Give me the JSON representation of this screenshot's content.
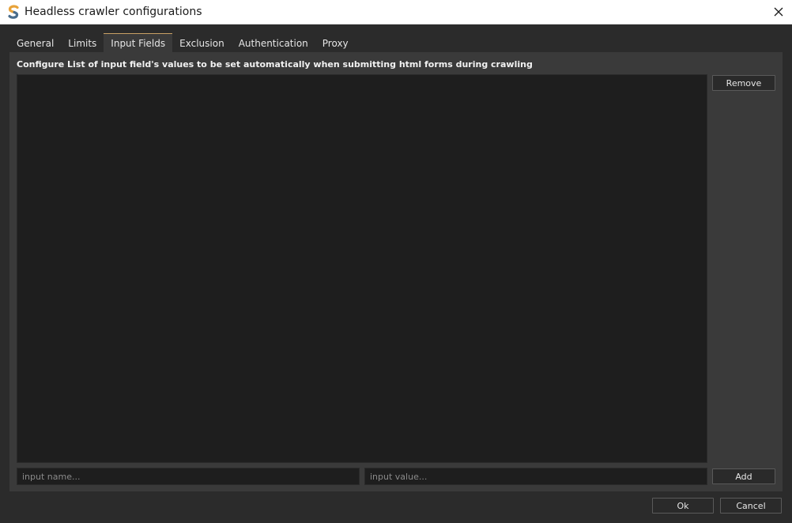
{
  "window": {
    "title": "Headless crawler configurations"
  },
  "tabs": [
    {
      "label": "General",
      "active": false
    },
    {
      "label": "Limits",
      "active": false
    },
    {
      "label": "Input Fields",
      "active": true
    },
    {
      "label": "Exclusion",
      "active": false
    },
    {
      "label": "Authentication",
      "active": false
    },
    {
      "label": "Proxy",
      "active": false
    }
  ],
  "panel": {
    "description": "Configure List of input field's values to be set automatically when submitting html forms during crawling",
    "remove_label": "Remove",
    "add_label": "Add",
    "name_input": {
      "value": "",
      "placeholder": "input name..."
    },
    "value_input": {
      "value": "",
      "placeholder": "input value..."
    }
  },
  "footer": {
    "ok_label": "Ok",
    "cancel_label": "Cancel"
  },
  "colors": {
    "accent": "#c8a165",
    "background": "#2b2b2b",
    "panel": "#3a3a3a",
    "list": "#1e1e1e"
  },
  "icons": {
    "app": "app-logo-icon",
    "close": "close-icon"
  }
}
